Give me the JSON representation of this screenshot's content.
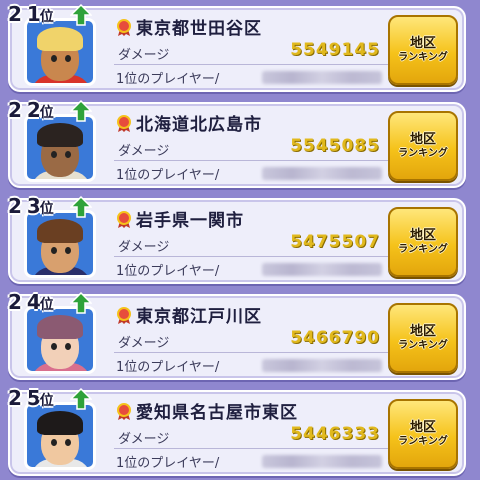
{
  "entries": [
    {
      "rank_num": "2 1",
      "rank_suffix": "位",
      "region": "東京都世田谷区",
      "damage_label": "ダメージ",
      "damage": "5549145",
      "top_label": "1位のプレイヤー/",
      "button_line1": "地区",
      "button_line2": "ランキング",
      "icons": [
        "up-arrow-icon",
        "ribbon-icon",
        "avatar"
      ],
      "avatar_bg": "#3a79d8",
      "hair": "#f0d36a",
      "skin": "#c9874e",
      "shirt": "#d8342b"
    },
    {
      "rank_num": "2 2",
      "rank_suffix": "位",
      "region": "北海道北広島市",
      "damage_label": "ダメージ",
      "damage": "5545085",
      "top_label": "1位のプレイヤー/",
      "button_line1": "地区",
      "button_line2": "ランキング",
      "icons": [
        "up-arrow-icon",
        "ribbon-icon",
        "avatar"
      ],
      "avatar_bg": "#3a79d8",
      "hair": "#2b2320",
      "skin": "#9a6a45",
      "shirt": "#e6e0d0"
    },
    {
      "rank_num": "2 3",
      "rank_suffix": "位",
      "region": "岩手県一関市",
      "damage_label": "ダメージ",
      "damage": "5475507",
      "top_label": "1位のプレイヤー/",
      "button_line1": "地区",
      "button_line2": "ランキング",
      "icons": [
        "up-arrow-icon",
        "ribbon-icon",
        "avatar"
      ],
      "avatar_bg": "#3a79d8",
      "hair": "#6a3f22",
      "skin": "#d8a06e",
      "shirt": "#2a2f6a"
    },
    {
      "rank_num": "2 4",
      "rank_suffix": "位",
      "region": "東京都江戸川区",
      "damage_label": "ダメージ",
      "damage": "5466790",
      "top_label": "1位のプレイヤー/",
      "button_line1": "地区",
      "button_line2": "ランキング",
      "icons": [
        "up-arrow-icon",
        "ribbon-icon",
        "avatar"
      ],
      "avatar_bg": "#3a79d8",
      "hair": "#8b5a72",
      "skin": "#f2d0b8",
      "shirt": "#d96f8d"
    },
    {
      "rank_num": "2 5",
      "rank_suffix": "位",
      "region": "愛知県名古屋市東区",
      "damage_label": "ダメージ",
      "damage": "5446333",
      "top_label": "1位のプレイヤー/",
      "button_line1": "地区",
      "button_line2": "ランキング",
      "icons": [
        "up-arrow-icon",
        "ribbon-icon",
        "avatar"
      ],
      "avatar_bg": "#3a79d8",
      "hair": "#1e1a1a",
      "skin": "#f0c8a0",
      "shirt": "#e8e8e8"
    }
  ],
  "colors": {
    "background": "#8f87cf",
    "card": "#eeeefa",
    "damage_value": "#e1b91d",
    "button": "#f5c21a",
    "arrow": "#2fa23a",
    "ribbon": "#c0392b"
  }
}
